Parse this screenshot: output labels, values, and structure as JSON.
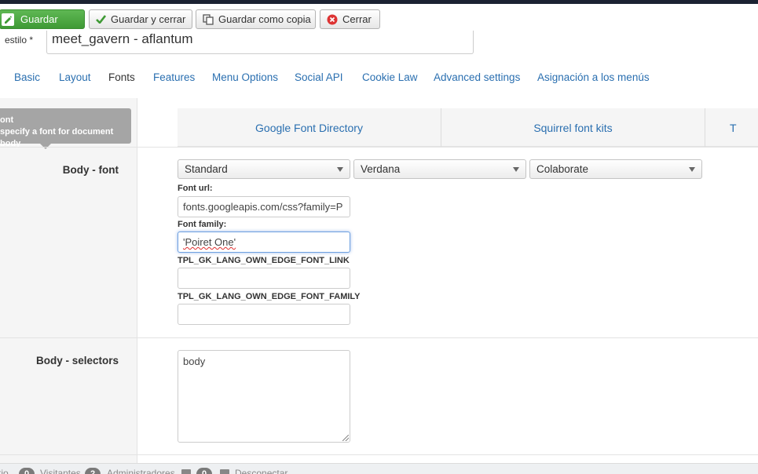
{
  "toolbar": {
    "save_label": "Guardar",
    "save_close_label": "Guardar y cerrar",
    "save_copy_label": "Guardar como copia",
    "close_label": "Cerrar"
  },
  "title": {
    "label": "estilo *",
    "value": "meet_gavern - aflantum"
  },
  "tabs": [
    {
      "label": "Basic"
    },
    {
      "label": "Layout"
    },
    {
      "label": "Fonts"
    },
    {
      "label": "Features"
    },
    {
      "label": "Menu Options"
    },
    {
      "label": "Social API"
    },
    {
      "label": "Cookie Law"
    },
    {
      "label": "Advanced settings"
    },
    {
      "label": "Asignación a los menús"
    }
  ],
  "tooltip": {
    "title": "ont",
    "text": "specify a font for document body"
  },
  "subtabs": [
    {
      "label": "Google Font Directory"
    },
    {
      "label": "Squirrel font kits"
    },
    {
      "label": "T"
    }
  ],
  "body_font": {
    "label": "Body - font",
    "selects": [
      "Standard",
      "Verdana",
      "Colaborate"
    ],
    "font_url_label": "Font url:",
    "font_url_value": "fonts.googleapis.com/css?family=P",
    "font_family_label": "Font family:",
    "font_family_value": "'Poiret One'",
    "own_link_label": "TPL_GK_LANG_OWN_EDGE_FONT_LINK",
    "own_link_value": "",
    "own_family_label": "TPL_GK_LANG_OWN_EDGE_FONT_FAMILY",
    "own_family_value": ""
  },
  "body_selectors": {
    "label": "Body - selectors",
    "value": "body"
  },
  "statusbar": {
    "site_label": "tio",
    "visitors_count": "0",
    "visitors_label": "Visitantes",
    "admins_count": "2",
    "admins_label": "Administradores",
    "messages_count": "0",
    "logout_label": "Desconectar"
  }
}
